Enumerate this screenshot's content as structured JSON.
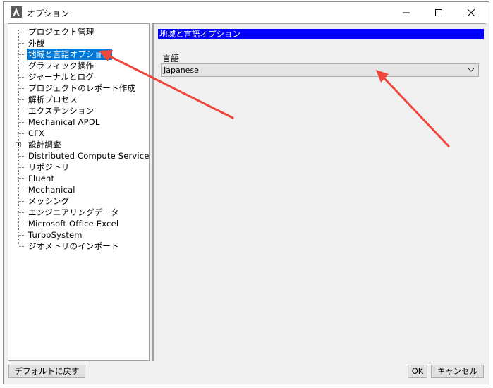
{
  "window": {
    "title": "オプション"
  },
  "tree": {
    "items": [
      {
        "label": "プロジェクト管理"
      },
      {
        "label": "外観"
      },
      {
        "label": "地域と言語オプション",
        "selected": true
      },
      {
        "label": "グラフィック操作"
      },
      {
        "label": "ジャーナルとログ"
      },
      {
        "label": "プロジェクトのレポート作成"
      },
      {
        "label": "解析プロセス"
      },
      {
        "label": "エクステンション"
      },
      {
        "label": "Mechanical APDL"
      },
      {
        "label": "CFX"
      },
      {
        "label": "設計調査",
        "expandable": true
      },
      {
        "label": "Distributed Compute Services"
      },
      {
        "label": "リポジトリ"
      },
      {
        "label": "Fluent"
      },
      {
        "label": "Mechanical"
      },
      {
        "label": "メッシング"
      },
      {
        "label": "エンジニアリングデータ"
      },
      {
        "label": "Microsoft Office Excel"
      },
      {
        "label": "TurboSystem"
      },
      {
        "label": "ジオメトリのインポート"
      }
    ]
  },
  "panel": {
    "header": "地域と言語オプション",
    "language_label": "言語",
    "language_value": "Japanese"
  },
  "buttons": {
    "restore_defaults": "デフォルトに戻す",
    "ok": "OK",
    "cancel": "キャンセル"
  },
  "colors": {
    "selection": "#0078d7",
    "panel_header": "#0000ff",
    "arrow": "#f0463c"
  }
}
